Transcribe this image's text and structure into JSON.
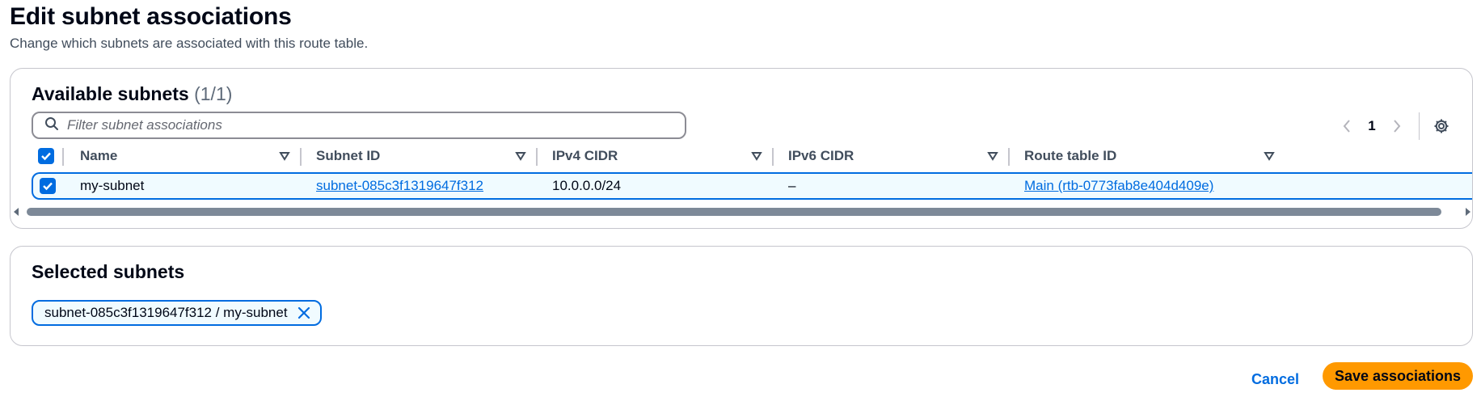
{
  "page": {
    "title": "Edit subnet associations",
    "description": "Change which subnets are associated with this route table."
  },
  "available": {
    "heading": "Available subnets",
    "count": "(1/1)",
    "filter_placeholder": "Filter subnet associations",
    "filter_value": "",
    "pagination": {
      "current_page": "1"
    },
    "columns": [
      "Name",
      "Subnet ID",
      "IPv4 CIDR",
      "IPv6 CIDR",
      "Route table ID"
    ],
    "rows": [
      {
        "selected": true,
        "name": "my-subnet",
        "subnet_id": "subnet-085c3f1319647f312",
        "ipv4_cidr": "10.0.0.0/24",
        "ipv6_cidr": "–",
        "route_table_id": "Main (rtb-0773fab8e404d409e)"
      }
    ],
    "select_all_checked": true
  },
  "selected": {
    "heading": "Selected subnets",
    "tokens": [
      {
        "label": "subnet-085c3f1319647f312 / my-subnet"
      }
    ]
  },
  "actions": {
    "cancel_label": "Cancel",
    "save_label": "Save associations"
  },
  "colors": {
    "accent": "#006ce0",
    "primary_button": "#ff9900",
    "row_selected_bg": "#f0fbff",
    "border": "#c6c6cd"
  }
}
